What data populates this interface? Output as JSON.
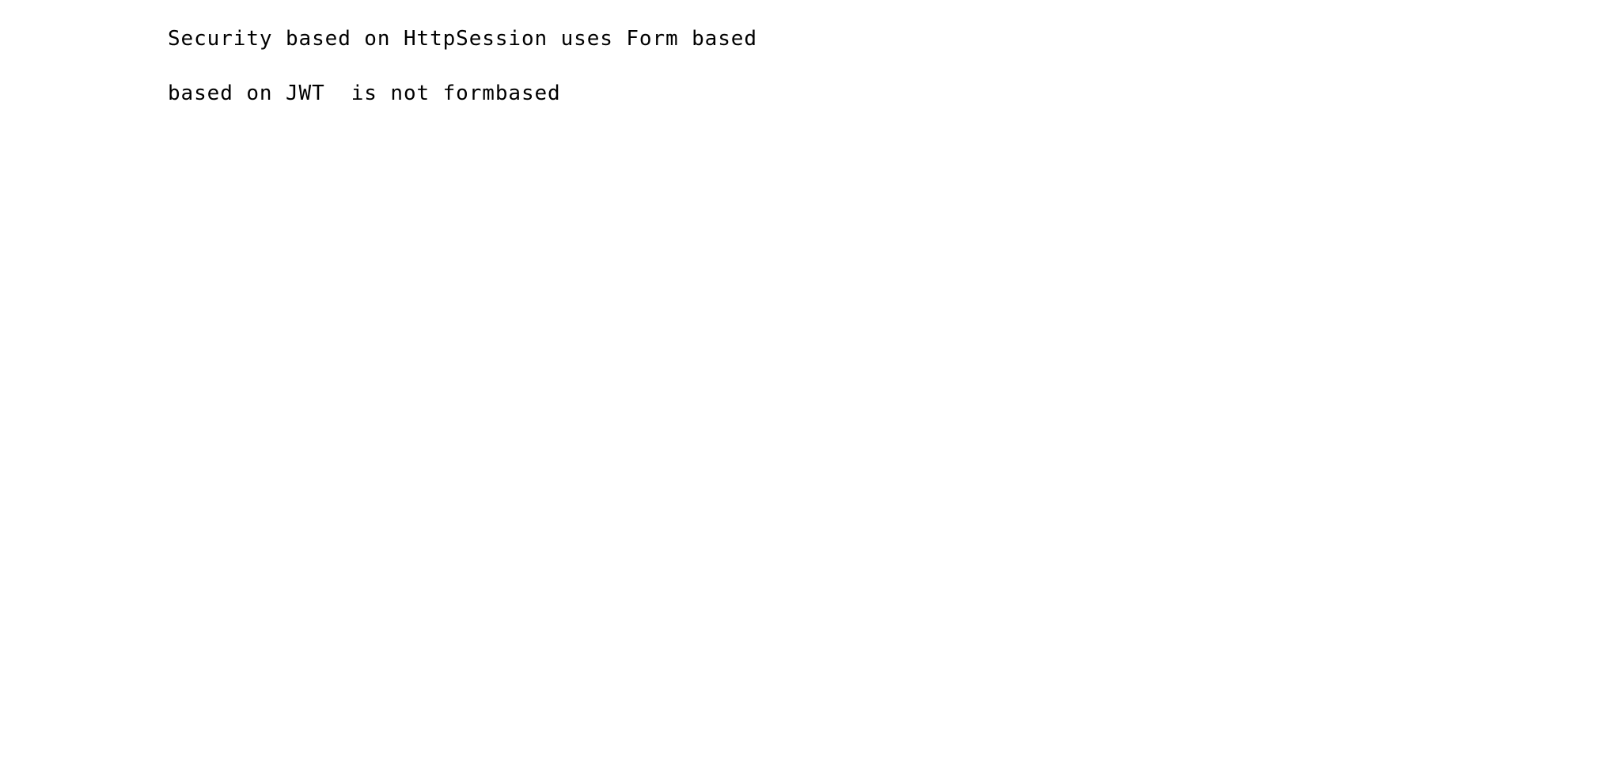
{
  "document": {
    "lines": [
      "Security based on HttpSession uses Form based",
      "based on JWT  is not formbased"
    ]
  }
}
